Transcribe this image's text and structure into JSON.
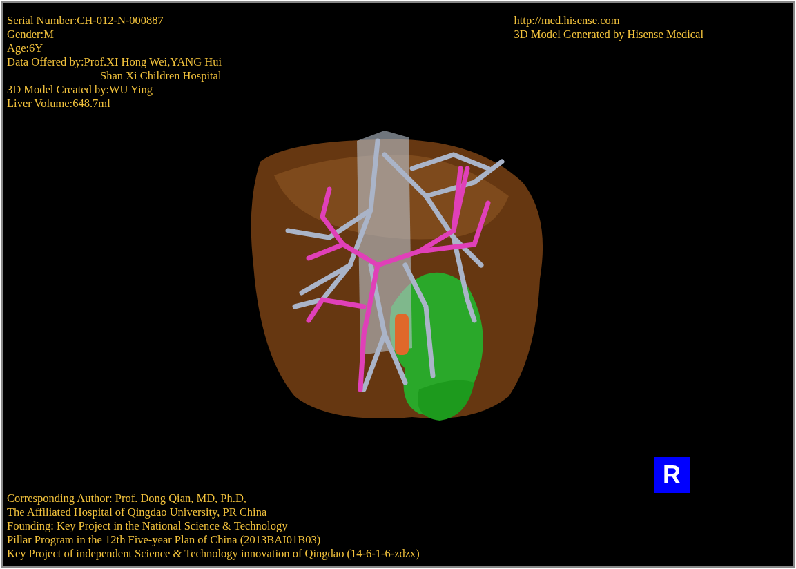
{
  "info_left": [
    {
      "lines": [
        "Serial Number:CH-012-N-000887"
      ]
    },
    {
      "lines": [
        "Gender:M"
      ]
    },
    {
      "lines": [
        "Age:6Y"
      ]
    },
    {
      "lines": [
        "Data Offered by:Prof.XI Hong Wei,YANG Hui",
        "Shan Xi Children Hospital"
      ]
    },
    {
      "lines": [
        "3D Model Created by:WU Ying"
      ]
    },
    {
      "lines": [
        "Liver Volume:648.7ml"
      ]
    }
  ],
  "info_right": [
    "http://med.hisense.com",
    "3D Model Generated by Hisense Medical"
  ],
  "credits": [
    "Corresponding Author: Prof. Dong Qian, MD, Ph.D,",
    "The Affiliated Hospital of Qingdao University, PR China",
    "Founding: Key Project in the National Science & Technology",
    "Pillar Program in the 12th Five-year Plan of China (2013BAI01B03)",
    "Key Project of independent Science & Technology innovation of Qingdao (14-6-1-6-zdzx)"
  ],
  "orientation_marker": "R"
}
